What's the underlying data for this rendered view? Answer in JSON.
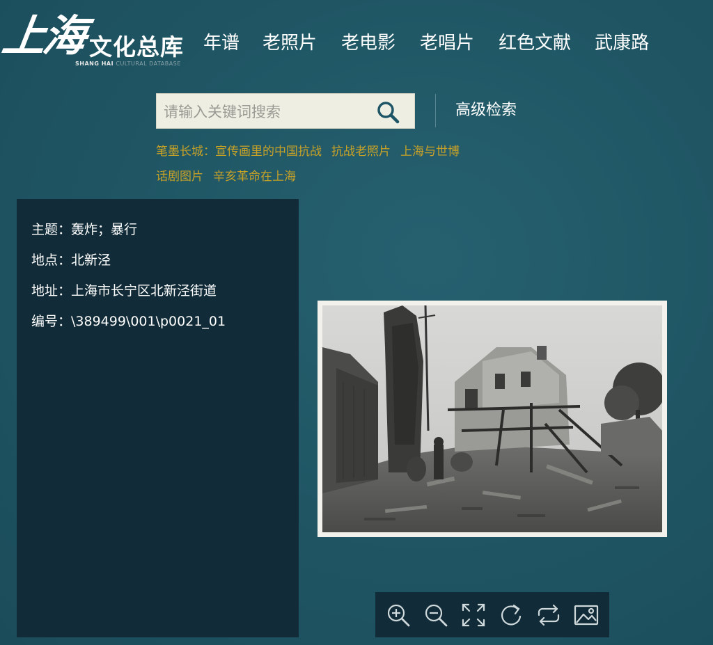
{
  "header": {
    "logo_main": "上海",
    "logo_sub": "文化总库",
    "logo_en_bold": "SHANG HAI",
    "logo_en_faint": "CULTURAL DATABASE",
    "nav": [
      {
        "label": "年谱"
      },
      {
        "label": "老照片"
      },
      {
        "label": "老电影"
      },
      {
        "label": "老唱片"
      },
      {
        "label": "红色文献"
      },
      {
        "label": "武康路"
      }
    ]
  },
  "search": {
    "placeholder": "请输入关键词搜索",
    "value": "",
    "advanced_label": "高级检索",
    "hot_links": [
      {
        "label": "笔墨长城：宣传画里的中国抗战"
      },
      {
        "label": "抗战老照片"
      },
      {
        "label": "上海与世博"
      },
      {
        "label": "话剧图片"
      },
      {
        "label": "辛亥革命在上海"
      }
    ]
  },
  "info": {
    "subject": "主题：轰炸；暴行",
    "place": "地点：北新泾",
    "address": "地址：上海市长宁区北新泾街道",
    "code": "编号：\\389499\\001\\p0021_01"
  },
  "toolbar": {
    "icons": [
      "zoom-in-icon",
      "zoom-out-icon",
      "fullscreen-icon",
      "rotate-icon",
      "swap-icon",
      "image-icon"
    ]
  },
  "colors": {
    "background": "#1f5563",
    "panel": "#112c38",
    "link_gold": "#c8a227",
    "search_bg": "#efeee2"
  }
}
